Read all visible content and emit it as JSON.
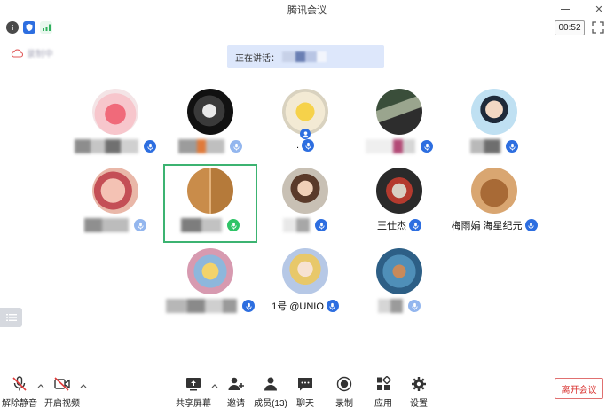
{
  "window": {
    "title": "腾讯会议"
  },
  "status": {
    "timer": "00:52",
    "recording_label": "录制中"
  },
  "speaker_banner": {
    "label": "正在讲话："
  },
  "participants": [
    {
      "name": "",
      "mic": "on"
    },
    {
      "name": "",
      "mic": "on"
    },
    {
      "name": ".",
      "mic": "on"
    },
    {
      "name": "",
      "mic": "on"
    },
    {
      "name": "",
      "mic": "on"
    },
    {
      "name": "",
      "mic": "dim"
    },
    {
      "name": "",
      "mic": "speaking"
    },
    {
      "name": "",
      "mic": "on"
    },
    {
      "name": "王仕杰",
      "mic": "on"
    },
    {
      "name": "梅雨娟 海星纪元",
      "mic": "on"
    },
    {
      "name": "",
      "mic": "on"
    },
    {
      "name": "1号 @UNIO",
      "mic": "on"
    },
    {
      "name": "",
      "mic": "dim"
    }
  ],
  "toolbar": {
    "unmute": "解除静音",
    "video": "开启视频",
    "share": "共享屏幕",
    "invite": "邀请",
    "members": "成员(13)",
    "chat": "聊天",
    "record": "录制",
    "apps": "应用",
    "settings": "设置",
    "leave": "离开会议"
  },
  "colors": {
    "accent": "#2d6ee0",
    "speaking": "#2fc467",
    "leave": "#d9322f",
    "banner": "#dde7fb"
  },
  "icons": [
    "info-icon",
    "shield-icon",
    "signal-icon",
    "fullscreen-icon",
    "cloud-icon",
    "list-icon",
    "mic-muted-icon",
    "video-off-icon",
    "share-screen-icon",
    "invite-icon",
    "members-icon",
    "chat-icon",
    "record-icon",
    "apps-icon",
    "gear-icon"
  ]
}
